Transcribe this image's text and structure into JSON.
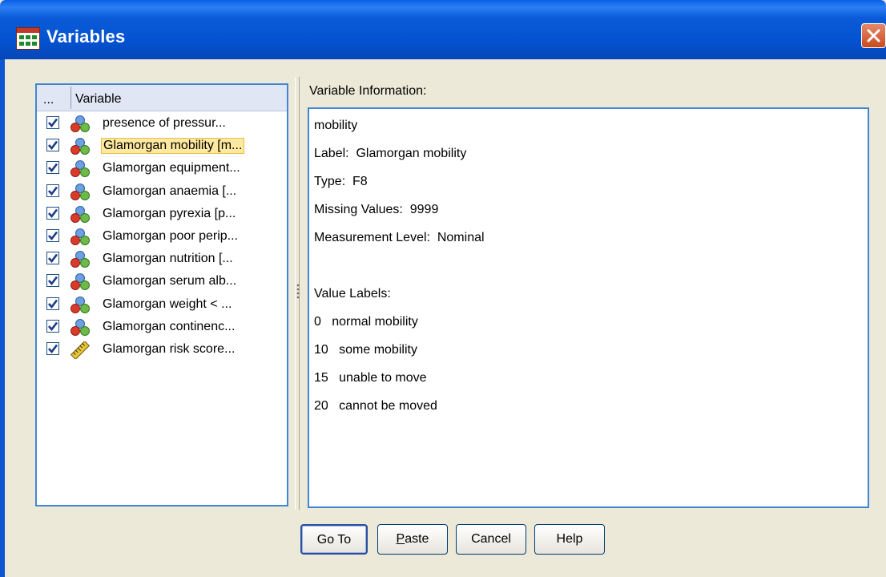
{
  "window": {
    "title": "Variables"
  },
  "list": {
    "header_dots": "...",
    "header_label": "Variable",
    "items": [
      {
        "label": "presence of pressur...",
        "checked": true,
        "icon": "nominal-variable-icon",
        "selected": false
      },
      {
        "label": "Glamorgan mobility [m...",
        "checked": true,
        "icon": "nominal-variable-icon",
        "selected": true
      },
      {
        "label": "Glamorgan equipment...",
        "checked": true,
        "icon": "nominal-variable-icon",
        "selected": false
      },
      {
        "label": "Glamorgan anaemia [...",
        "checked": true,
        "icon": "nominal-variable-icon",
        "selected": false
      },
      {
        "label": "Glamorgan pyrexia [p...",
        "checked": true,
        "icon": "nominal-variable-icon",
        "selected": false
      },
      {
        "label": "Glamorgan poor perip...",
        "checked": true,
        "icon": "nominal-variable-icon",
        "selected": false
      },
      {
        "label": "Glamorgan nutrition [...",
        "checked": true,
        "icon": "nominal-variable-icon",
        "selected": false
      },
      {
        "label": "Glamorgan serum alb...",
        "checked": true,
        "icon": "nominal-variable-icon",
        "selected": false
      },
      {
        "label": "Glamorgan weight < ...",
        "checked": true,
        "icon": "nominal-variable-icon",
        "selected": false
      },
      {
        "label": "Glamorgan continenc...",
        "checked": true,
        "icon": "nominal-variable-icon",
        "selected": false
      },
      {
        "label": "Glamorgan risk score...",
        "checked": true,
        "icon": "scale-variable-icon",
        "selected": false
      }
    ]
  },
  "info": {
    "title": "Variable Information:",
    "name": "mobility",
    "label_line": "Label:  Glamorgan mobility",
    "type_line": "Type:  F8",
    "missing_line": "Missing Values:  9999",
    "measurement_line": "Measurement Level:  Nominal",
    "value_labels_title": "Value Labels:",
    "value_labels": [
      "0   normal mobility",
      "10   some mobility",
      "15   unable to move",
      "20   cannot be moved"
    ]
  },
  "buttons": {
    "goto": "Go To",
    "paste_first": "P",
    "paste_rest": "aste",
    "cancel": "Cancel",
    "help": "Help"
  },
  "colors": {
    "titlebar": "#0452d1",
    "panel_border": "#3f87d6",
    "selection": "#ffe8a0",
    "dialog_bg": "#ece9d8"
  }
}
